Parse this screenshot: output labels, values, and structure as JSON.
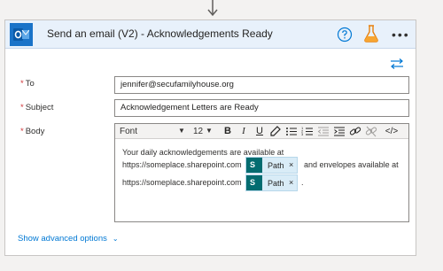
{
  "action": {
    "title": "Send an email (V2) - Acknowledgements Ready",
    "app_icon": "outlook-icon",
    "accent": "#1a73c8"
  },
  "fields": {
    "to": {
      "label": "To",
      "value": "jennifer@secufamilyhouse.org"
    },
    "subject": {
      "label": "Subject",
      "value": "Acknowledgement Letters are Ready"
    },
    "body": {
      "label": "Body"
    }
  },
  "toolbar": {
    "font": "Font",
    "size": "12",
    "bold": "B",
    "italic": "I",
    "underline": "U",
    "code": "</>"
  },
  "body_content": {
    "line1": "Your daily acknowledgements are available at",
    "line2_prefix": "https://someplace.sharepoint.com",
    "line2_suffix": "and envelopes available at",
    "line3_prefix": "https://someplace.sharepoint.com",
    "line3_suffix": ".",
    "token_label": "Path",
    "token_close": "×",
    "token_color": "#036c70"
  },
  "footer": {
    "advanced_label": "Show advanced options"
  },
  "required_marker": "*"
}
